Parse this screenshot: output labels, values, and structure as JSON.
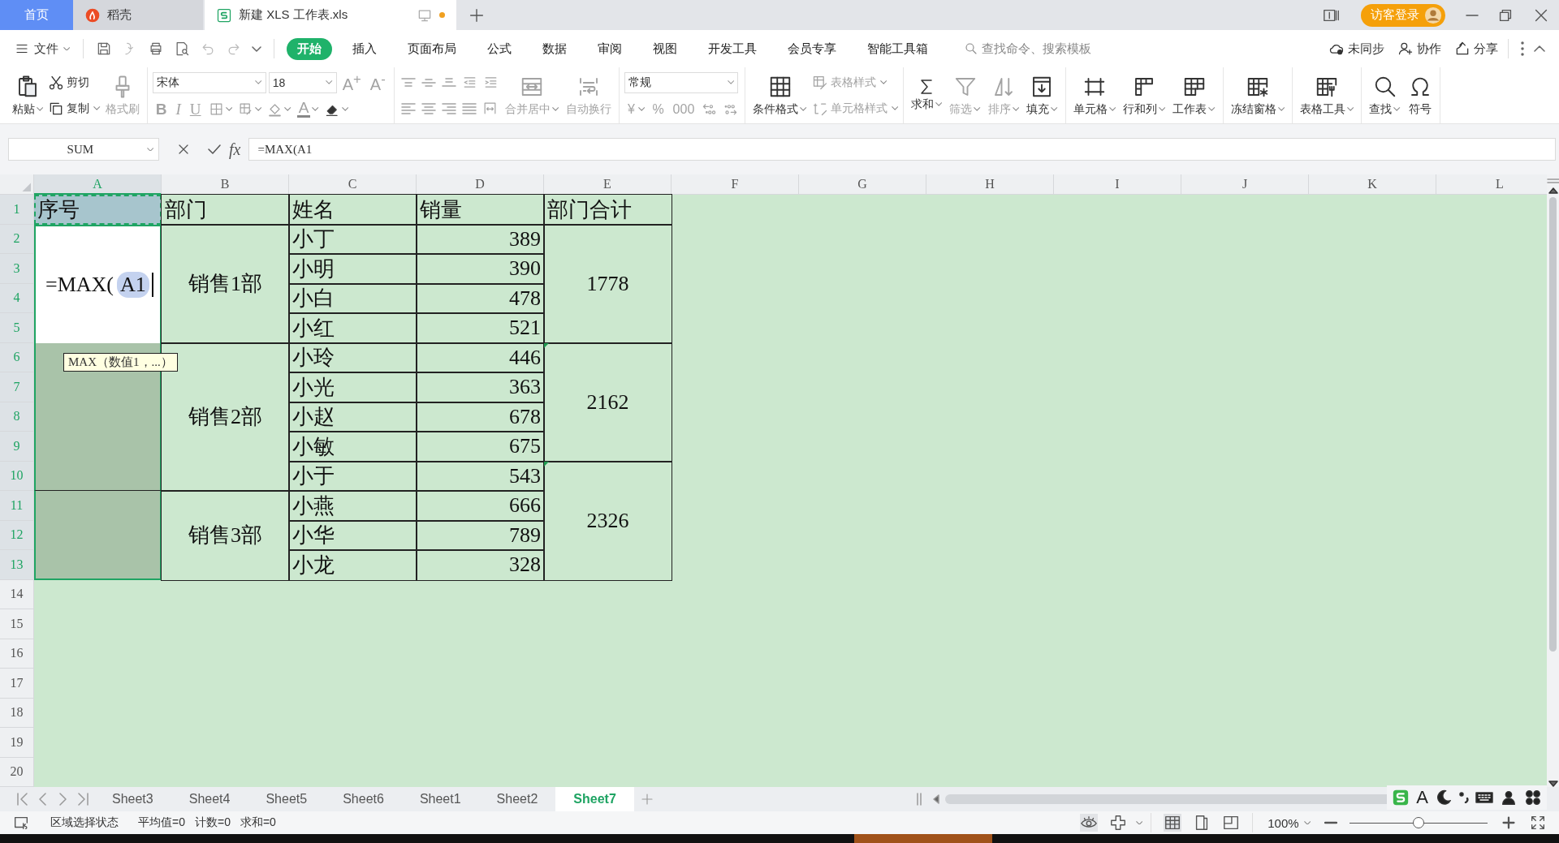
{
  "tabs": [
    {
      "label": "首页",
      "kind": "home",
      "selected": false,
      "unsaved": false
    },
    {
      "label": "稻壳",
      "kind": "docer",
      "selected": false,
      "unsaved": false
    },
    {
      "label": "新建 XLS 工作表.xls",
      "kind": "sheet",
      "selected": true,
      "unsaved": true
    }
  ],
  "account": {
    "login": "访客登录"
  },
  "menu": {
    "file": "文件",
    "tabs": [
      {
        "label": "开始",
        "selected": true
      },
      {
        "label": "插入",
        "selected": false
      },
      {
        "label": "页面布局",
        "selected": false
      },
      {
        "label": "公式",
        "selected": false
      },
      {
        "label": "数据",
        "selected": false
      },
      {
        "label": "审阅",
        "selected": false
      },
      {
        "label": "视图",
        "selected": false
      },
      {
        "label": "开发工具",
        "selected": false
      },
      {
        "label": "会员专享",
        "selected": false
      },
      {
        "label": "智能工具箱",
        "selected": false
      }
    ],
    "search_placeholder": "查找命令、搜索模板",
    "actions": [
      "未同步",
      "协作",
      "分享"
    ]
  },
  "ribbon": [
    {
      "columns": [
        {
          "kind": "large",
          "label": "粘贴",
          "dropdown": true,
          "disabled": false
        },
        {
          "kind": "stack",
          "top": [
            {
              "kind": "small",
              "label": "剪切",
              "dropdown": false,
              "disabled": false
            }
          ],
          "bottom": [
            {
              "kind": "small",
              "label": "复制",
              "dropdown": true,
              "disabled": false
            }
          ]
        },
        {
          "kind": "large",
          "label": "格式刷",
          "dropdown": false,
          "disabled": true
        }
      ]
    },
    {
      "columns": [
        {
          "kind": "stack",
          "top": [
            {
              "kind": "combo",
              "value": "宋体"
            },
            {
              "kind": "combo",
              "value": "18"
            },
            {
              "kind": "glyph",
              "glyph": "A$^{+}$",
              "dropdown": false,
              "disabled": true
            },
            {
              "kind": "glyph",
              "glyph": "A$^{-}$",
              "dropdown": false,
              "disabled": true
            }
          ],
          "bottom": [
            {
              "kind": "glyph",
              "glyph": "B",
              "dropdown": false,
              "disabled": true
            },
            {
              "kind": "glyph",
              "glyph": "I",
              "dropdown": false,
              "disabled": true
            },
            {
              "kind": "glyph",
              "glyph": "U",
              "dropdown": false,
              "disabled": true
            },
            {
              "kind": "icon",
              "dropdown": true,
              "disabled": true
            },
            {
              "kind": "icon",
              "dropdown": true,
              "disabled": true
            },
            {
              "kind": "icon",
              "dropdown": true,
              "disabled": true
            },
            {
              "kind": "glyph",
              "glyph": "A",
              "dropdown": true,
              "disabled": true
            },
            {
              "kind": "icon",
              "dropdown": true,
              "disabled": false
            }
          ]
        }
      ]
    },
    {
      "columns": [
        {
          "kind": "stack",
          "top": [
            {
              "kind": "icon",
              "dropdown": false,
              "disabled": true
            },
            {
              "kind": "icon",
              "dropdown": false,
              "disabled": true
            },
            {
              "kind": "icon",
              "dropdown": false,
              "disabled": true
            },
            {
              "kind": "icon",
              "dropdown": false,
              "disabled": true
            },
            {
              "kind": "icon",
              "dropdown": false,
              "disabled": true
            }
          ],
          "bottom": [
            {
              "kind": "icon",
              "dropdown": false,
              "disabled": true
            },
            {
              "kind": "icon",
              "dropdown": false,
              "disabled": true
            },
            {
              "kind": "icon",
              "dropdown": false,
              "disabled": true
            },
            {
              "kind": "icon",
              "dropdown": false,
              "disabled": true
            },
            {
              "kind": "icon",
              "dropdown": false,
              "disabled": true
            }
          ]
        },
        {
          "kind": "large",
          "label": "合并居中",
          "dropdown": true,
          "disabled": true
        },
        {
          "kind": "large",
          "label": "自动换行",
          "dropdown": false,
          "disabled": true
        }
      ]
    },
    {
      "columns": [
        {
          "kind": "stack",
          "top": [
            {
              "kind": "combo",
              "value": "常规"
            }
          ],
          "bottom": [
            {
              "kind": "glyph",
              "glyph": "¥",
              "dropdown": true,
              "disabled": true
            },
            {
              "kind": "glyph",
              "glyph": "%",
              "dropdown": false,
              "disabled": true
            },
            {
              "kind": "glyph",
              "glyph": "000",
              "dropdown": false,
              "disabled": true
            },
            {
              "kind": "icon",
              "dropdown": false,
              "disabled": true
            },
            {
              "kind": "icon",
              "dropdown": false,
              "disabled": true
            }
          ]
        }
      ]
    },
    {
      "columns": [
        {
          "kind": "large",
          "label": "条件格式",
          "dropdown": true,
          "disabled": false
        },
        {
          "kind": "stack",
          "top": [
            {
              "kind": "small",
              "label": "表格样式",
              "dropdown": true,
              "disabled": true
            }
          ],
          "bottom": [
            {
              "kind": "small",
              "label": "单元格样式",
              "dropdown": true,
              "disabled": true
            }
          ]
        }
      ]
    },
    {
      "columns": [
        {
          "kind": "large",
          "label": "求和",
          "dropdown": true,
          "disabled": false
        },
        {
          "kind": "large",
          "label": "筛选",
          "dropdown": true,
          "disabled": true
        },
        {
          "kind": "large",
          "label": "排序",
          "dropdown": true,
          "disabled": true
        },
        {
          "kind": "large",
          "label": "填充",
          "dropdown": true,
          "disabled": false
        }
      ]
    },
    {
      "columns": [
        {
          "kind": "large",
          "label": "单元格",
          "dropdown": true,
          "disabled": false
        },
        {
          "kind": "large",
          "label": "行和列",
          "dropdown": true,
          "disabled": false
        },
        {
          "kind": "large",
          "label": "工作表",
          "dropdown": true,
          "disabled": false
        }
      ]
    },
    {
      "columns": [
        {
          "kind": "large",
          "label": "冻结窗格",
          "dropdown": true,
          "disabled": false
        }
      ]
    },
    {
      "columns": [
        {
          "kind": "large",
          "label": "表格工具",
          "dropdown": true,
          "disabled": false
        }
      ]
    },
    {
      "columns": [
        {
          "kind": "large",
          "label": "查找",
          "dropdown": true,
          "disabled": false
        },
        {
          "kind": "large",
          "label": "符号",
          "dropdown": false,
          "disabled": false
        }
      ]
    }
  ],
  "formula_bar": {
    "name_box": "SUM",
    "fx": "fx",
    "formula": "=MAX(A1"
  },
  "sheet": {
    "columns": [
      {
        "label": "A",
        "selected": true
      },
      {
        "label": "B",
        "selected": false
      },
      {
        "label": "C",
        "selected": false
      },
      {
        "label": "D",
        "selected": false
      },
      {
        "label": "E",
        "selected": false
      },
      {
        "label": "F",
        "selected": false
      },
      {
        "label": "G",
        "selected": false
      },
      {
        "label": "H",
        "selected": false
      },
      {
        "label": "I",
        "selected": false
      },
      {
        "label": "J",
        "selected": false
      },
      {
        "label": "K",
        "selected": false
      },
      {
        "label": "L",
        "selected": false
      }
    ],
    "rows": [
      {
        "label": "1",
        "selected": true
      },
      {
        "label": "2",
        "selected": true
      },
      {
        "label": "3",
        "selected": true
      },
      {
        "label": "4",
        "selected": true
      },
      {
        "label": "5",
        "selected": true
      },
      {
        "label": "6",
        "selected": true
      },
      {
        "label": "7",
        "selected": true
      },
      {
        "label": "8",
        "selected": true
      },
      {
        "label": "9",
        "selected": true
      },
      {
        "label": "10",
        "selected": true
      },
      {
        "label": "11",
        "selected": true
      },
      {
        "label": "12",
        "selected": true
      },
      {
        "label": "13",
        "selected": true
      },
      {
        "label": "14",
        "selected": false
      },
      {
        "label": "15",
        "selected": false
      },
      {
        "label": "16",
        "selected": false
      },
      {
        "label": "17",
        "selected": false
      },
      {
        "label": "18",
        "selected": false
      },
      {
        "label": "19",
        "selected": false
      },
      {
        "label": "20",
        "selected": false
      }
    ],
    "table": [
      {
        "cells": [
          {
            "kind": "referenced",
            "text": "序号",
            "selected": false
          },
          {
            "kind": "header",
            "text": "部门",
            "selected": false
          },
          {
            "kind": "header",
            "text": "姓名",
            "selected": false
          },
          {
            "kind": "header",
            "text": "销量",
            "selected": false
          },
          {
            "kind": "header",
            "text": "部门合计",
            "selected": false
          }
        ]
      },
      {
        "cells": [
          {
            "kind": "editing",
            "text": "=MAX(",
            "reference": "A1",
            "selected": false
          },
          {
            "kind": "center",
            "text": "销售1部",
            "selected": false
          },
          {
            "kind": "label",
            "text": "小丁",
            "selected": false
          },
          {
            "kind": "number",
            "text": "389",
            "selected": false
          },
          {
            "kind": "center",
            "text": "1778",
            "selected": false,
            "flag": false
          }
        ]
      },
      {
        "cells": [
          {
            "kind": "continued"
          },
          {
            "kind": "continued"
          },
          {
            "kind": "label",
            "text": "小明",
            "selected": false
          },
          {
            "kind": "number",
            "text": "390",
            "selected": false
          },
          {
            "kind": "continued"
          }
        ]
      },
      {
        "cells": [
          {
            "kind": "continued"
          },
          {
            "kind": "continued"
          },
          {
            "kind": "label",
            "text": "小白",
            "selected": false
          },
          {
            "kind": "number",
            "text": "478",
            "selected": false
          },
          {
            "kind": "continued"
          }
        ]
      },
      {
        "cells": [
          {
            "kind": "continued"
          },
          {
            "kind": "continued"
          },
          {
            "kind": "label",
            "text": "小红",
            "selected": false
          },
          {
            "kind": "number",
            "text": "521",
            "selected": false
          },
          {
            "kind": "continued"
          }
        ]
      },
      {
        "cells": [
          {
            "kind": "blank",
            "selected": true
          },
          {
            "kind": "center",
            "text": "销售2部",
            "selected": false
          },
          {
            "kind": "label",
            "text": "小玲",
            "selected": false
          },
          {
            "kind": "number",
            "text": "446",
            "selected": false
          },
          {
            "kind": "center",
            "text": "2162",
            "selected": false,
            "flag": true
          }
        ]
      },
      {
        "cells": [
          {
            "kind": "continued"
          },
          {
            "kind": "continued"
          },
          {
            "kind": "label",
            "text": "小光",
            "selected": false
          },
          {
            "kind": "number",
            "text": "363",
            "selected": false
          },
          {
            "kind": "continued"
          }
        ]
      },
      {
        "cells": [
          {
            "kind": "continued"
          },
          {
            "kind": "continued"
          },
          {
            "kind": "label",
            "text": "小赵",
            "selected": false
          },
          {
            "kind": "number",
            "text": "678",
            "selected": false
          },
          {
            "kind": "continued"
          }
        ]
      },
      {
        "cells": [
          {
            "kind": "continued"
          },
          {
            "kind": "continued"
          },
          {
            "kind": "label",
            "text": "小敏",
            "selected": false
          },
          {
            "kind": "number",
            "text": "675",
            "selected": false
          },
          {
            "kind": "continued"
          }
        ]
      },
      {
        "cells": [
          {
            "kind": "continued"
          },
          {
            "kind": "continued"
          },
          {
            "kind": "label",
            "text": "小于",
            "selected": false
          },
          {
            "kind": "number",
            "text": "543",
            "selected": false
          },
          {
            "kind": "center",
            "text": "2326",
            "selected": false,
            "flag": true
          }
        ]
      },
      {
        "cells": [
          {
            "kind": "blank",
            "selected": true
          },
          {
            "kind": "center",
            "text": "销售3部",
            "selected": false
          },
          {
            "kind": "label",
            "text": "小燕",
            "selected": false
          },
          {
            "kind": "number",
            "text": "666",
            "selected": false
          },
          {
            "kind": "continued"
          }
        ]
      },
      {
        "cells": [
          {
            "kind": "continued"
          },
          {
            "kind": "continued"
          },
          {
            "kind": "label",
            "text": "小华",
            "selected": false
          },
          {
            "kind": "number",
            "text": "789",
            "selected": false
          },
          {
            "kind": "continued"
          }
        ]
      },
      {
        "cells": [
          {
            "kind": "continued"
          },
          {
            "kind": "continued"
          },
          {
            "kind": "label",
            "text": "小龙",
            "selected": false
          },
          {
            "kind": "number",
            "text": "328",
            "selected": false
          },
          {
            "kind": "continued"
          }
        ]
      }
    ],
    "tooltip": "MAX（数值1，...）"
  },
  "sheet_tabs": [
    {
      "label": "Sheet3",
      "selected": false
    },
    {
      "label": "Sheet4",
      "selected": false
    },
    {
      "label": "Sheet5",
      "selected": false
    },
    {
      "label": "Sheet6",
      "selected": false
    },
    {
      "label": "Sheet1",
      "selected": false
    },
    {
      "label": "Sheet2",
      "selected": false
    },
    {
      "label": "Sheet7",
      "selected": true
    }
  ],
  "status_bar": {
    "mode": "区域选择状态",
    "stats": [
      "平均值=0",
      "计数=0",
      "求和=0"
    ],
    "views": [
      {
        "selected": true
      },
      {
        "selected": false
      },
      {
        "selected": false
      }
    ],
    "zoom": {
      "label": "100%",
      "level": 0.5
    }
  },
  "ime": {
    "mode": "A"
  }
}
